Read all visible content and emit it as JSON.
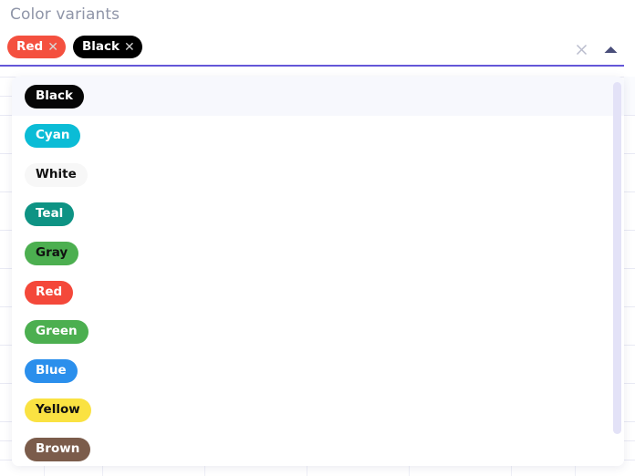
{
  "field": {
    "label": "Color variants",
    "clear_icon": "close-icon",
    "toggle_icon": "caret-up-icon",
    "underline_color": "#6457d8"
  },
  "selected": [
    {
      "label": "Red",
      "bg": "#f4503f",
      "fg": "#ffffff",
      "remove_icon": "✕"
    },
    {
      "label": "Black",
      "bg": "#000000",
      "fg": "#ffffff",
      "remove_icon": "✕"
    }
  ],
  "menu": {
    "focused_index": 0,
    "options": [
      {
        "label": "Black",
        "bg": "#060606",
        "fg": "#ffffff"
      },
      {
        "label": "Cyan",
        "bg": "#0bbcd6",
        "fg": "#ffffff"
      },
      {
        "label": "White",
        "bg": "#f7f7f7",
        "fg": "#111111"
      },
      {
        "label": "Teal",
        "bg": "#0e9384",
        "fg": "#ffffff"
      },
      {
        "label": "Gray",
        "bg": "#4caf50",
        "fg": "#111111"
      },
      {
        "label": "Red",
        "bg": "#f4483a",
        "fg": "#ffffff"
      },
      {
        "label": "Green",
        "bg": "#4caf50",
        "fg": "#ffffff"
      },
      {
        "label": "Blue",
        "bg": "#2b8fec",
        "fg": "#ffffff"
      },
      {
        "label": "Yellow",
        "bg": "#fae242",
        "fg": "#111111"
      },
      {
        "label": "Brown",
        "bg": "#7b5c4b",
        "fg": "#ffffff"
      }
    ]
  },
  "scrollbar": {
    "thumb_color": "#e3e2f7"
  }
}
